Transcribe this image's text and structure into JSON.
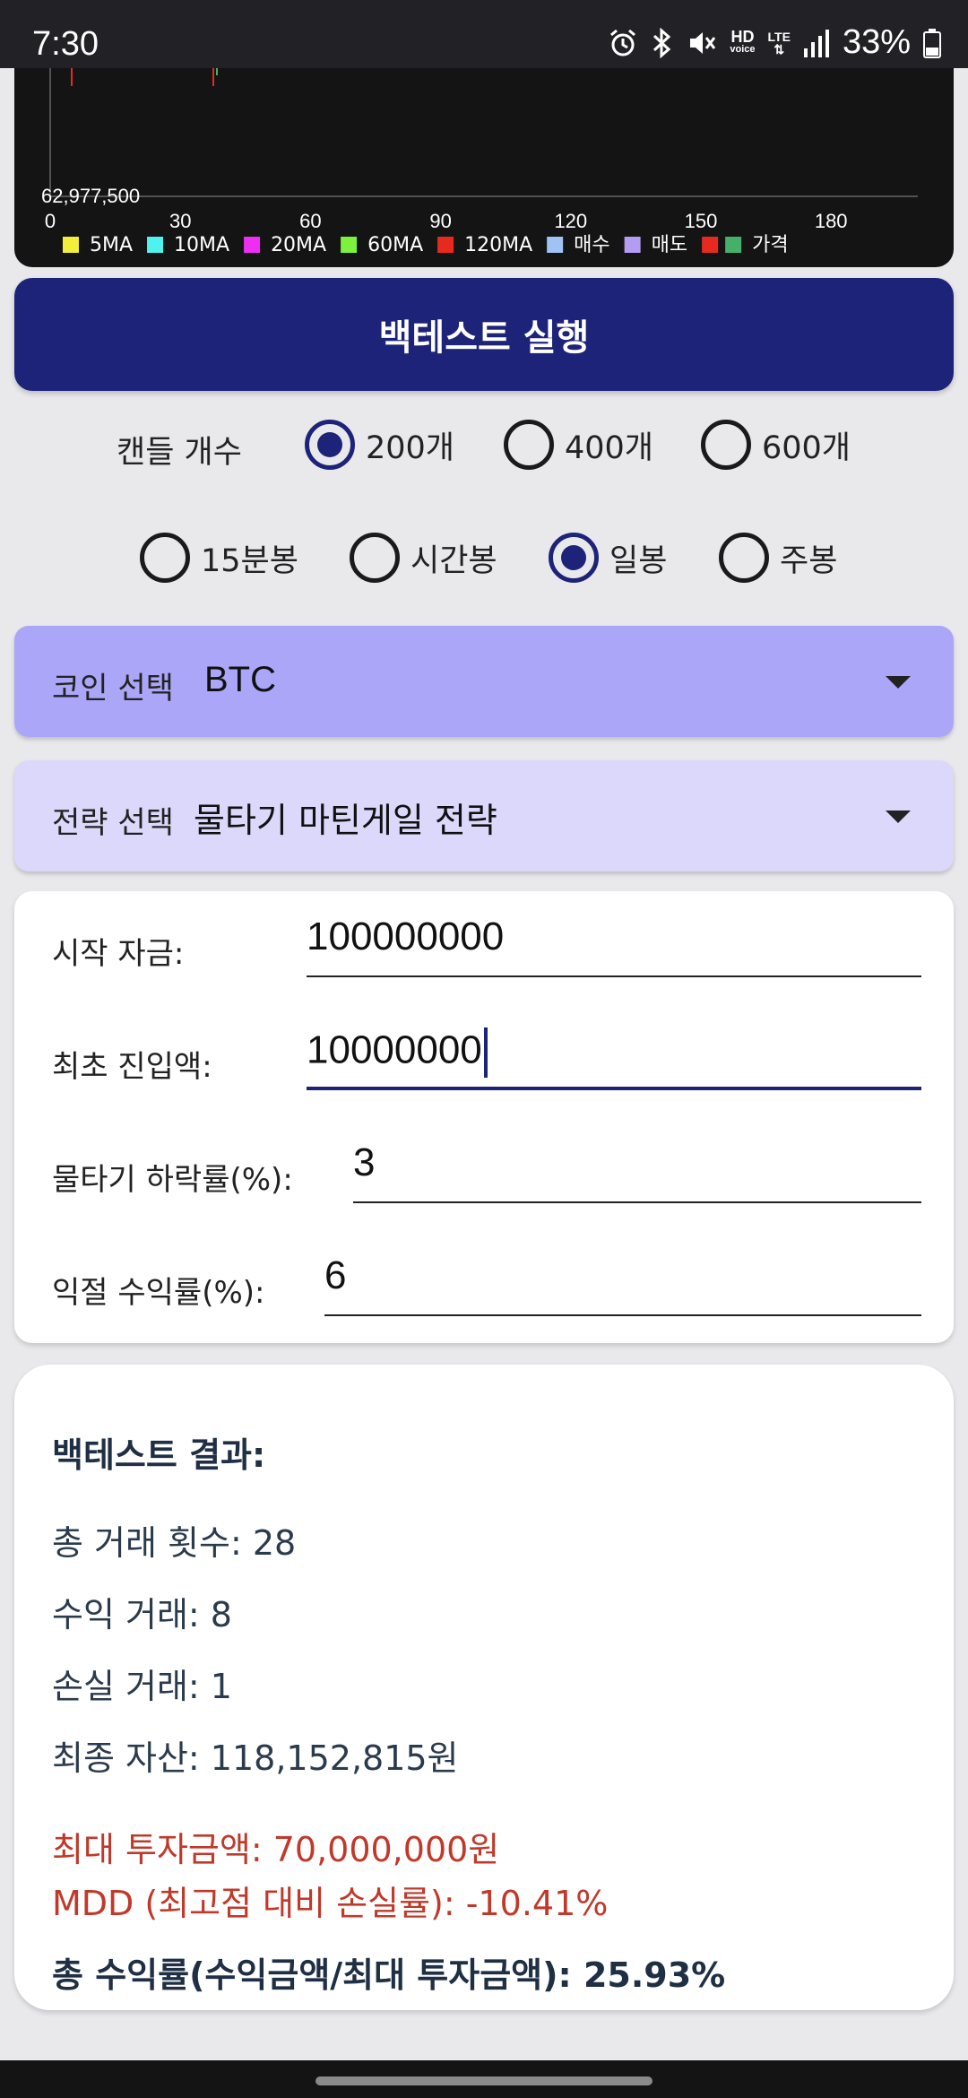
{
  "status_bar": {
    "time": "7:30",
    "battery": "33%",
    "hd_top": "HD",
    "hd_bottom": "voice",
    "lte": "LTE",
    "icons": [
      "alarm-icon",
      "bluetooth-icon",
      "mute-icon",
      "hd-voice-icon",
      "lte-icon",
      "signal-icon",
      "battery-icon"
    ]
  },
  "chart_data": {
    "type": "line",
    "x_ticks": [
      "0",
      "30",
      "60",
      "90",
      "120",
      "150",
      "180"
    ],
    "xlim": [
      0,
      200
    ],
    "y_label_min": "62,977,500",
    "legend": [
      {
        "name": "5MA",
        "color": "#f4ee3a"
      },
      {
        "name": "10MA",
        "color": "#4ff2ee"
      },
      {
        "name": "20MA",
        "color": "#ee2ef0"
      },
      {
        "name": "60MA",
        "color": "#7cf23c"
      },
      {
        "name": "120MA",
        "color": "#e62a1f"
      },
      {
        "name": "매수",
        "color": "#9fc3f2"
      },
      {
        "name": "매도",
        "color": "#b49cf2"
      },
      {
        "name": "가격",
        "colors": [
          "#e62a1f",
          "#46b06a"
        ]
      }
    ]
  },
  "run_button": {
    "label": "백테스트 실행"
  },
  "candle_count": {
    "label": "캔들 개수",
    "options": [
      "200개",
      "400개",
      "600개"
    ],
    "selected": 0
  },
  "interval": {
    "options": [
      "15분봉",
      "시간봉",
      "일봉",
      "주봉"
    ],
    "selected": 2
  },
  "coin_select": {
    "label": "코인 선택",
    "value": "BTC"
  },
  "strategy_select": {
    "label": "전략 선택",
    "value": "물타기 마틴게일 전략"
  },
  "inputs": {
    "start_capital": {
      "label": "시작 자금:",
      "value": "100000000"
    },
    "initial_entry": {
      "label": "최초 진입액:",
      "value": "10000000"
    },
    "drop_rate": {
      "label": "물타기 하락률(%):",
      "value": "3"
    },
    "take_profit": {
      "label": "익절 수익률(%):",
      "value": "6"
    }
  },
  "results": {
    "title": "백테스트 결과:",
    "total_trades": "총 거래 횟수: 28",
    "win_trades": "수익 거래: 8",
    "loss_trades": "손실 거래: 1",
    "final_assets": "최종 자산: 118,152,815원",
    "max_investment": "최대 투자금액: 70,000,000원",
    "mdd": "MDD (최고점 대비 손실률): -10.41%",
    "total_return": "총 수익률(수익금액/최대 투자금액): 25.93%"
  }
}
